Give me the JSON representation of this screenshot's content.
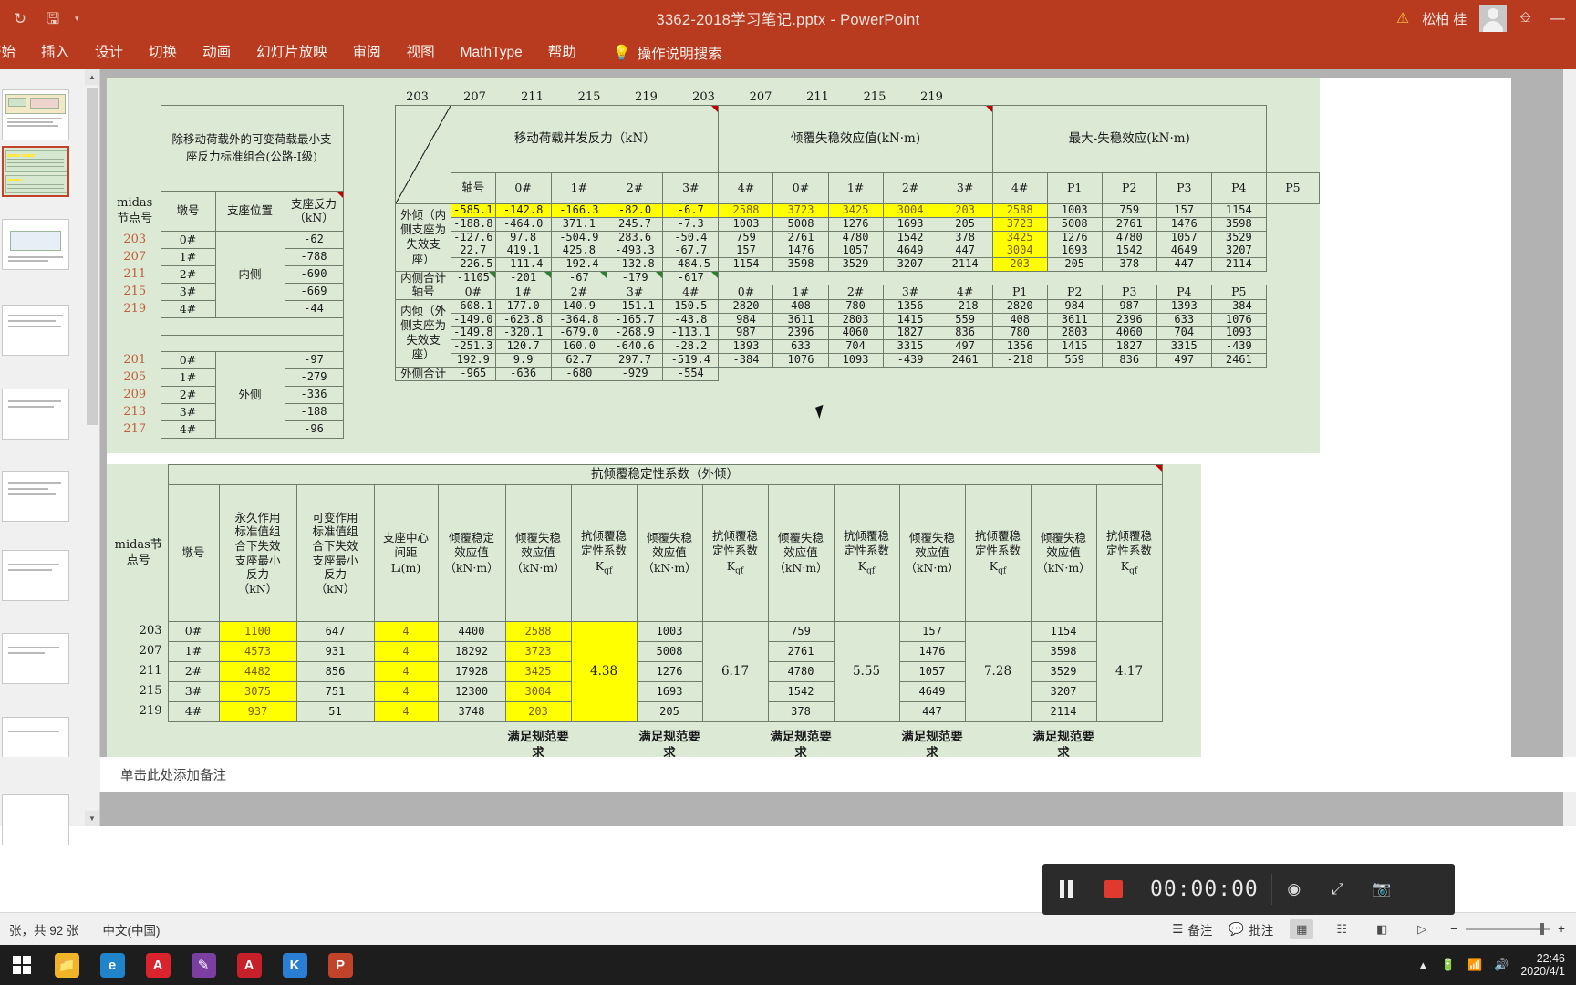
{
  "titlebar": {
    "save_icon": "save-icon",
    "undo_icon": "undo-icon",
    "customize_caret": "▾",
    "document_title": "3362-2018学习笔记.pptx  -  PowerPoint",
    "warning_icon": "warning-icon",
    "user_name": "松柏 桂",
    "ribbon_display_icon": "ribbon-display-options-icon",
    "minimize_label": "—"
  },
  "ribbon": {
    "tabs": [
      {
        "label": "开始"
      },
      {
        "label": "插入"
      },
      {
        "label": "设计"
      },
      {
        "label": "切换"
      },
      {
        "label": "动画"
      },
      {
        "label": "幻灯片放映"
      },
      {
        "label": "审阅"
      },
      {
        "label": "视图"
      },
      {
        "label": "MathType"
      },
      {
        "label": "帮助"
      }
    ],
    "tellme_label": "操作说明搜索",
    "tellme_icon": "lightbulb-icon"
  },
  "notes": {
    "placeholder": "单击此处添加备注"
  },
  "statusbar": {
    "slide_count": "张，共 92 张",
    "language": "中文(中国)",
    "notes_label": "备注",
    "comments_label": "批注",
    "notes_icon": "notes-icon",
    "comments_icon": "comment-icon",
    "views": [
      "normal-view-icon",
      "slide-sorter-icon",
      "reading-view-icon",
      "slideshow-icon"
    ],
    "zoom_out": "−",
    "zoom_in": "+"
  },
  "recording_toolbar": {
    "pause_label": "pause-button",
    "stop_label": "stop-button",
    "timer": "00:00:00",
    "screenshot_label": "camera-icon",
    "fullscreen_label": "expand-icon",
    "snapshot_label": "capture-icon"
  },
  "taskbar": {
    "start_icon": "windows-start-icon",
    "apps": [
      {
        "name": "file-explorer",
        "glyph": "🗀",
        "color": "#f5b942"
      },
      {
        "name": "microsoft-edge",
        "glyph": "e",
        "color": "#1f84c9"
      },
      {
        "name": "adobe-app",
        "glyph": "A",
        "color": "#d9232d"
      },
      {
        "name": "onenote-app",
        "glyph": "✎",
        "color": "#7a3fa0"
      },
      {
        "name": "pdf-reader",
        "glyph": "A",
        "color": "#c8202b"
      },
      {
        "name": "kingsoft-app",
        "glyph": "K",
        "color": "#2a7fd4"
      },
      {
        "name": "powerpoint-app",
        "glyph": "P",
        "color": "#c0432a"
      }
    ],
    "tray_icons": [
      "show-hidden-icons",
      "battery-icon",
      "wifi-icon",
      "volume-icon"
    ],
    "clock_time": "22:46",
    "clock_date": "2020/4/1"
  },
  "slide": {
    "table_top": {
      "left_block": {
        "title": "除移动荷载外的可变荷载最小支座反力标准组合(公路-I级)",
        "row_header": "midas节点号",
        "headers": [
          "墩号",
          "支座位置",
          "支座反力（kN）"
        ],
        "group_inner_label": "内侧",
        "group_outer_label": "外侧",
        "inner_rows": [
          {
            "node": "203",
            "pier": "0#",
            "reaction": "-62"
          },
          {
            "node": "207",
            "pier": "1#",
            "reaction": "-788"
          },
          {
            "node": "211",
            "pier": "2#",
            "reaction": "-690"
          },
          {
            "node": "215",
            "pier": "3#",
            "reaction": "-669"
          },
          {
            "node": "219",
            "pier": "4#",
            "reaction": "-44"
          }
        ],
        "outer_rows": [
          {
            "node": "201",
            "pier": "0#",
            "reaction": "-97"
          },
          {
            "node": "205",
            "pier": "1#",
            "reaction": "-279"
          },
          {
            "node": "209",
            "pier": "2#",
            "reaction": "-336"
          },
          {
            "node": "213",
            "pier": "3#",
            "reaction": "-188"
          },
          {
            "node": "217",
            "pier": "4#",
            "reaction": "-96"
          }
        ]
      },
      "node_banner": [
        "203",
        "207",
        "211",
        "215",
        "219",
        "203",
        "207",
        "211",
        "215",
        "219"
      ],
      "group_titles": {
        "moving": "移动荷载并发反力（kN）",
        "overturn": "倾覆失稳效应值(kN·m)",
        "maxmin": "最大-失稳效应(kN·m)"
      },
      "axis_label": "轴号",
      "axis_cols": [
        "0#",
        "1#",
        "2#",
        "3#",
        "4#"
      ],
      "pier_cols": [
        "P1",
        "P2",
        "P3",
        "P4",
        "P5"
      ],
      "outward_label": "外倾（内侧支座为失效支座）",
      "inward_label": "内倾（外侧支座为失效支座）",
      "inner_total_label": "内侧合计",
      "outer_total_label": "外侧合计",
      "outward": {
        "moving": [
          [
            "-585.1",
            "-142.8",
            "-166.3",
            "-82.0",
            "-6.7"
          ],
          [
            "-188.8",
            "-464.0",
            "371.1",
            "245.7",
            "-7.3"
          ],
          [
            "-127.6",
            "97.8",
            "-504.9",
            "283.6",
            "-50.4"
          ],
          [
            "22.7",
            "419.1",
            "425.8",
            "-493.3",
            "-67.7"
          ],
          [
            "-226.5",
            "-111.4",
            "-192.4",
            "-132.8",
            "-484.5"
          ]
        ],
        "moving_highlight_row": 0,
        "overturn": [
          [
            "2588",
            "3723",
            "3425",
            "3004",
            "203"
          ],
          [
            "1003",
            "5008",
            "1276",
            "1693",
            "205"
          ],
          [
            "759",
            "2761",
            "4780",
            "1542",
            "378"
          ],
          [
            "157",
            "1476",
            "1057",
            "4649",
            "447"
          ],
          [
            "1154",
            "3598",
            "3529",
            "3207",
            "2114"
          ]
        ],
        "overturn_highlight_row": 0,
        "maxmin": [
          [
            "2588",
            "1003",
            "759",
            "157",
            "1154"
          ],
          [
            "3723",
            "5008",
            "2761",
            "1476",
            "3598"
          ],
          [
            "3425",
            "1276",
            "4780",
            "1057",
            "3529"
          ],
          [
            "3004",
            "1693",
            "1542",
            "4649",
            "3207"
          ],
          [
            "203",
            "205",
            "378",
            "447",
            "2114"
          ]
        ],
        "maxmin_highlight_col": 0,
        "totals": [
          "-1105",
          "-201",
          "-67",
          "-179",
          "-617"
        ]
      },
      "inward": {
        "moving": [
          [
            "-608.1",
            "177.0",
            "140.9",
            "-151.1",
            "150.5"
          ],
          [
            "-149.0",
            "-623.8",
            "-364.8",
            "-165.7",
            "-43.8"
          ],
          [
            "-149.8",
            "-320.1",
            "-679.0",
            "-268.9",
            "-113.1"
          ],
          [
            "-251.3",
            "120.7",
            "160.0",
            "-640.6",
            "-28.2"
          ],
          [
            "192.9",
            "9.9",
            "62.7",
            "297.7",
            "-519.4"
          ]
        ],
        "overturn": [
          [
            "2820",
            "408",
            "780",
            "1356",
            "-218"
          ],
          [
            "984",
            "3611",
            "2803",
            "1415",
            "559"
          ],
          [
            "987",
            "2396",
            "4060",
            "1827",
            "836"
          ],
          [
            "1393",
            "633",
            "704",
            "3315",
            "497"
          ],
          [
            "-384",
            "1076",
            "1093",
            "-439",
            "2461"
          ]
        ],
        "maxmin": [
          [
            "2820",
            "984",
            "987",
            "1393",
            "-384"
          ],
          [
            "408",
            "3611",
            "2396",
            "633",
            "1076"
          ],
          [
            "780",
            "2803",
            "4060",
            "704",
            "1093"
          ],
          [
            "1356",
            "1415",
            "1827",
            "3315",
            "-439"
          ],
          [
            "-218",
            "559",
            "836",
            "497",
            "2461"
          ]
        ],
        "totals": [
          "-965",
          "-636",
          "-680",
          "-929",
          "-554"
        ]
      }
    },
    "table_bottom": {
      "title": "抗倾覆稳定性系数（外倾）",
      "row_header": "midas节点号",
      "headers": [
        "墩号",
        "永久作用标准值组合下失效支座最小反力（kN）",
        "可变作用标准值组合下失效支座最小反力（kN）",
        "支座中心间距 Lᵢ(m)",
        "倾覆稳定效应值（kN·m）",
        "倾覆失稳效应值（kN·m）",
        "抗倾覆稳定性系数 K_qf",
        "倾覆失稳效应值（kN·m）",
        "抗倾覆稳定性系数 K_qf",
        "倾覆失稳效应值（kN·m）",
        "抗倾覆稳定性系数 K_qf",
        "倾覆失稳效应值（kN·m）",
        "抗倾覆稳定性系数 K_qf",
        "倾覆失稳效应值（kN·m）",
        "抗倾覆稳定性系数 K_qf"
      ],
      "header_parts": {
        "pier": "墩号",
        "perm": [
          "永久作用",
          "标准值组",
          "合下失效",
          "支座最小",
          "反力",
          "（kN）"
        ],
        "var": [
          "可变作用",
          "标准值组",
          "合下失效",
          "支座最小",
          "反力",
          "（kN）"
        ],
        "span": [
          "支座中心",
          "间距",
          "Lᵢ(m)"
        ],
        "stable": [
          "倾覆稳定",
          "效应值",
          "（kN·m）"
        ],
        "unstable": [
          "倾覆失稳",
          "效应值",
          "（kN·m）"
        ],
        "coef": [
          "抗倾覆稳",
          "定性系数",
          "K"
        ],
        "coef_sub": "qf"
      },
      "rows": [
        {
          "node": "203",
          "pier": "0#",
          "perm": "1100",
          "var": "647",
          "span": "4",
          "stable": "4400",
          "u1": "2588",
          "u2": "1003",
          "u3": "759",
          "u4": "157",
          "u5": "1154"
        },
        {
          "node": "207",
          "pier": "1#",
          "perm": "4573",
          "var": "931",
          "span": "4",
          "stable": "18292",
          "u1": "3723",
          "u2": "5008",
          "u3": "2761",
          "u4": "1476",
          "u5": "3598"
        },
        {
          "node": "211",
          "pier": "2#",
          "perm": "4482",
          "var": "856",
          "span": "4",
          "stable": "17928",
          "u1": "3425",
          "u2": "1276",
          "u3": "4780",
          "u4": "1057",
          "u5": "3529"
        },
        {
          "node": "215",
          "pier": "3#",
          "perm": "3075",
          "var": "751",
          "span": "4",
          "stable": "12300",
          "u1": "3004",
          "u2": "1693",
          "u3": "1542",
          "u4": "4649",
          "u5": "3207"
        },
        {
          "node": "219",
          "pier": "4#",
          "perm": "937",
          "var": "51",
          "span": "4",
          "stable": "3748",
          "u1": "203",
          "u2": "205",
          "u3": "378",
          "u4": "447",
          "u5": "2114"
        }
      ],
      "coefficients": [
        "4.38",
        "6.17",
        "5.55",
        "7.28",
        "4.17"
      ],
      "verdict": "满足规范要求"
    }
  }
}
